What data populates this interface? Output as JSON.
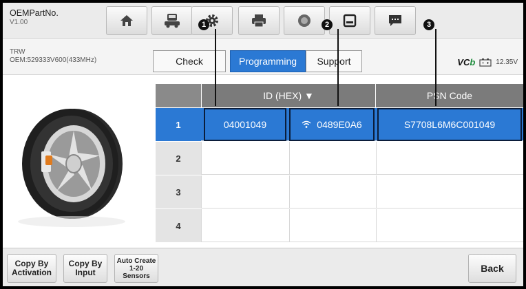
{
  "toolbar": {
    "title": "OEMPartNo.",
    "version": "V1.00",
    "icons": [
      "home-icon",
      "vehicle-swap-icon",
      "settings-icon",
      "print-icon",
      "help-icon",
      "save-icon",
      "message-icon"
    ]
  },
  "info": {
    "make": "TRW",
    "oem": "OEM:529333V600(433MHz)",
    "vci_logo_a": "VC",
    "vci_logo_b": "b",
    "voltage": "12.35V"
  },
  "tabs": {
    "check": "Check",
    "programming": "Programming",
    "support": "Support",
    "active": "Programming"
  },
  "table": {
    "header_id": "ID (HEX) ▼",
    "header_psn": "PSN Code",
    "rows": [
      {
        "num": "1",
        "id": "04001049",
        "id2": "0489E0A6",
        "psn": "S7708L6M6C001049"
      },
      {
        "num": "2",
        "id": "",
        "id2": "",
        "psn": ""
      },
      {
        "num": "3",
        "id": "",
        "id2": "",
        "psn": ""
      },
      {
        "num": "4",
        "id": "",
        "id2": "",
        "psn": ""
      }
    ]
  },
  "callouts": [
    "1",
    "2",
    "3"
  ],
  "bottom": {
    "copy_activation": "Copy By\nActivation",
    "copy_input": "Copy By\nInput",
    "auto_create": "Auto Create\n1-20\nSensors",
    "back": "Back"
  },
  "colors": {
    "accent_blue": "#2b79d4",
    "header_gray": "#7b7b7b"
  }
}
